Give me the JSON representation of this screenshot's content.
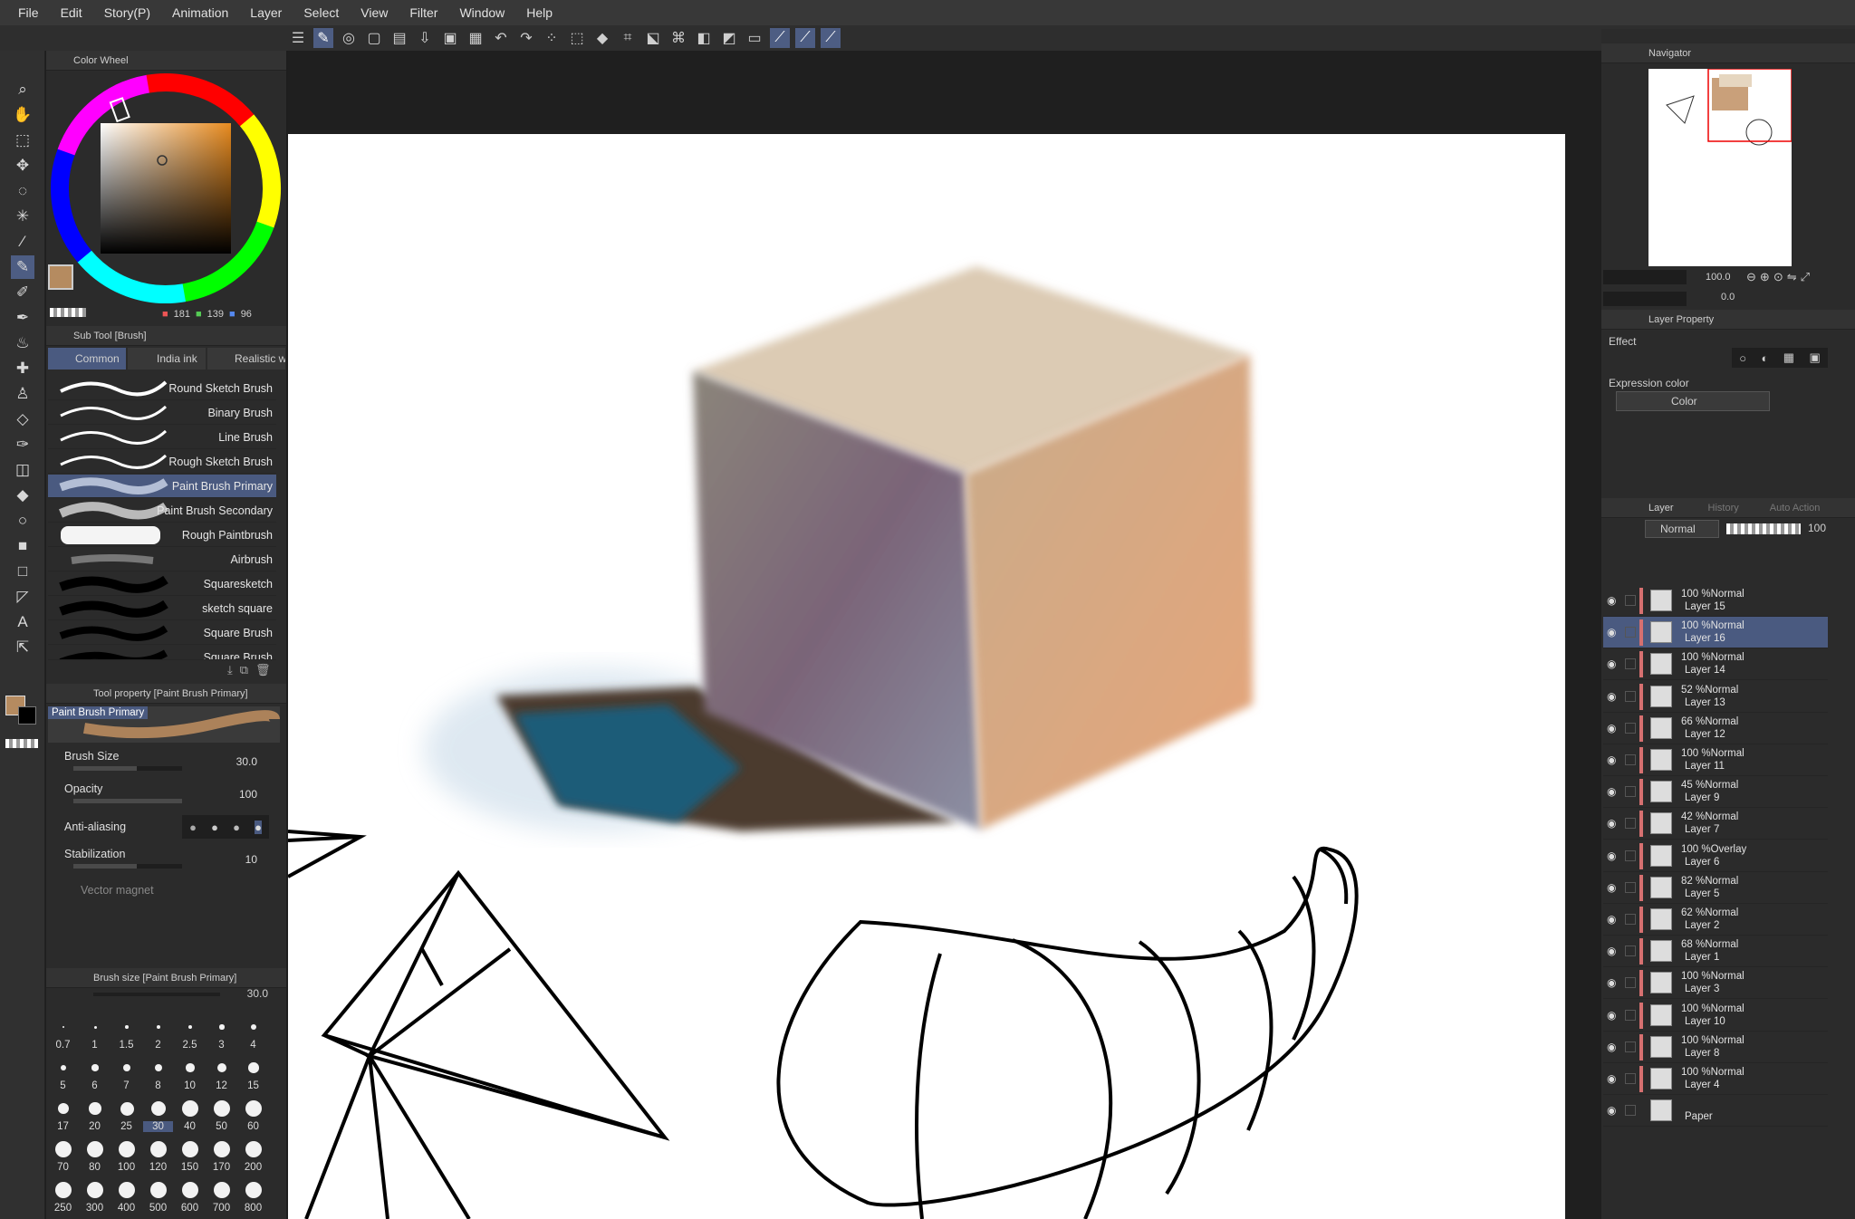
{
  "menu": [
    "File",
    "Edit",
    "Story(P)",
    "Animation",
    "Layer",
    "Select",
    "View",
    "Filter",
    "Window",
    "Help"
  ],
  "colorwheel": {
    "title": "Color Wheel",
    "r": "181",
    "g": "139",
    "b": "96",
    "main_color": "#b58b60"
  },
  "subtool": {
    "title": "Sub Tool [Brush]",
    "tabs": [
      "Common",
      "India ink",
      "Realistic w"
    ],
    "brushes": [
      "Round Sketch Brush",
      "Binary Brush",
      "Line Brush",
      "Rough Sketch Brush",
      "Paint Brush Primary",
      "Paint Brush Secondary",
      "Rough Paintbrush",
      "Airbrush",
      "Squaresketch",
      "sketch square",
      "Square Brush",
      "Square Brush"
    ]
  },
  "toolprop": {
    "title": "Tool property [Paint Brush Primary]",
    "preview_label": "Paint Brush Primary",
    "brush_size_label": "Brush Size",
    "brush_size": "30.0",
    "opacity_label": "Opacity",
    "opacity": "100",
    "antialias_label": "Anti-aliasing",
    "stabilization_label": "Stabilization",
    "stabilization": "10",
    "vector_magnet_label": "Vector magnet"
  },
  "brushsize": {
    "title": "Brush size [Paint Brush Primary]",
    "value": "30.0",
    "sizes": [
      "0.7",
      "1",
      "1.5",
      "2",
      "2.5",
      "3",
      "4",
      "5",
      "6",
      "7",
      "8",
      "10",
      "12",
      "15",
      "17",
      "20",
      "25",
      "30",
      "40",
      "50",
      "60",
      "70",
      "80",
      "100",
      "120",
      "150",
      "170",
      "200",
      "250",
      "300",
      "400",
      "500",
      "600",
      "700",
      "800"
    ]
  },
  "navigator": {
    "title": "Navigator",
    "zoom": "100.0",
    "rotate": "0.0"
  },
  "layerproperty": {
    "title": "Layer Property",
    "effect_label": "Effect",
    "expression_label": "Expression color",
    "expression_value": "Color"
  },
  "layerpanel": {
    "tabs": [
      "Layer",
      "History",
      "Auto Action"
    ],
    "blend": "Normal",
    "opacity": "100",
    "layers": [
      {
        "line1": "100 %Normal",
        "line2": "Layer 15"
      },
      {
        "line1": "100 %Normal",
        "line2": "Layer 16"
      },
      {
        "line1": "100 %Normal",
        "line2": "Layer 14"
      },
      {
        "line1": "52 %Normal",
        "line2": "Layer 13"
      },
      {
        "line1": "66 %Normal",
        "line2": "Layer 12"
      },
      {
        "line1": "100 %Normal",
        "line2": "Layer 11"
      },
      {
        "line1": "45 %Normal",
        "line2": "Layer 9"
      },
      {
        "line1": "42 %Normal",
        "line2": "Layer 7"
      },
      {
        "line1": "100 %Overlay",
        "line2": "Layer 6"
      },
      {
        "line1": "82 %Normal",
        "line2": "Layer 5"
      },
      {
        "line1": "62 %Normal",
        "line2": "Layer 2"
      },
      {
        "line1": "68 %Normal",
        "line2": "Layer 1"
      },
      {
        "line1": "100 %Normal",
        "line2": "Layer 3"
      },
      {
        "line1": "100 %Normal",
        "line2": "Layer 10"
      },
      {
        "line1": "100 %Normal",
        "line2": "Layer 8"
      },
      {
        "line1": "100 %Normal",
        "line2": "Layer 4"
      },
      {
        "line1": "",
        "line2": "Paper"
      }
    ]
  }
}
